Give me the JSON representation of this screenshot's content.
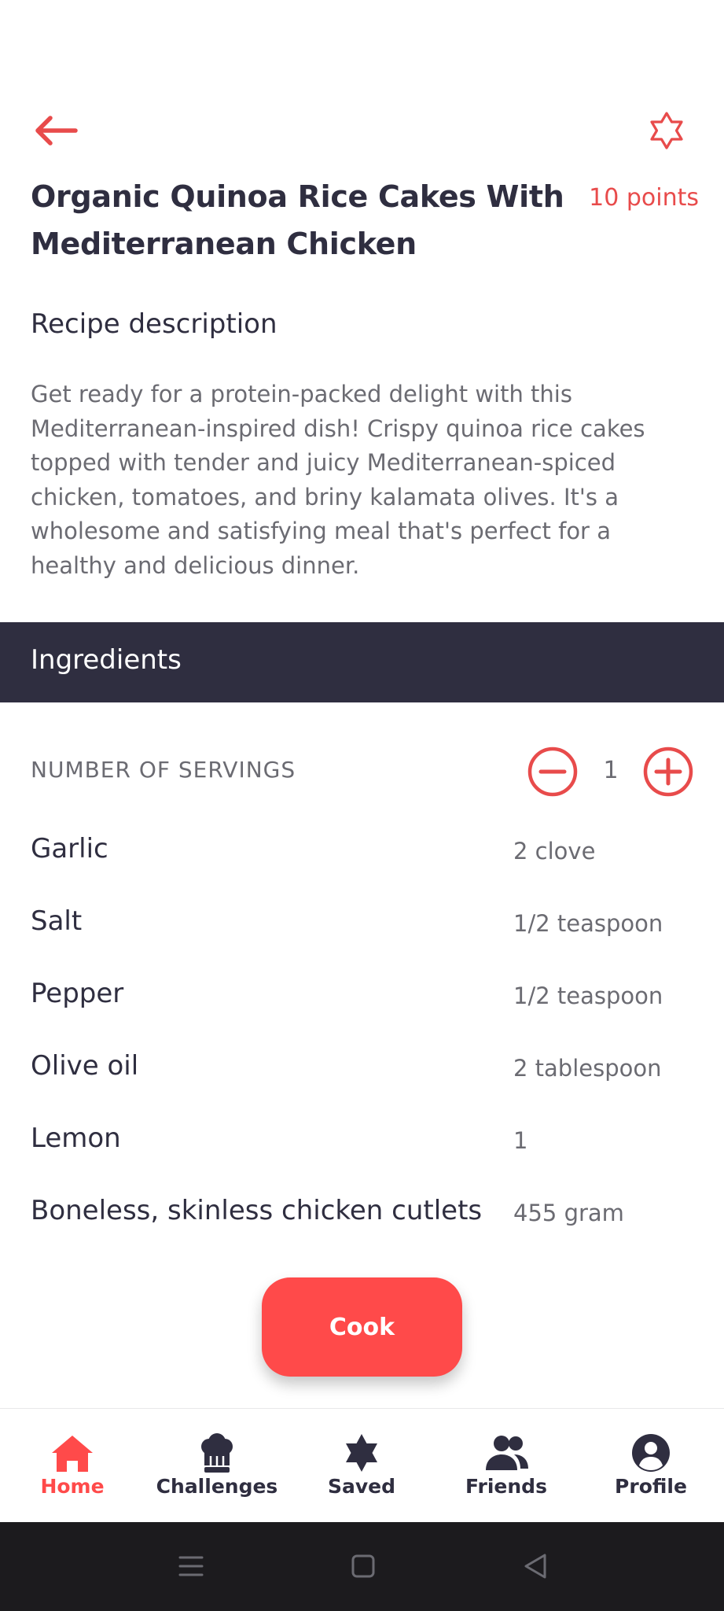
{
  "recipe": {
    "title": "Organic Quinoa Rice Cakes With Mediterranean Chicken",
    "points": "10 points",
    "description_label": "Recipe description",
    "description": "Get ready for a protein-packed delight with this Mediterranean-inspired dish! Crispy quinoa rice cakes topped with tender and juicy Mediterranean-spiced chicken, tomatoes, and briny kalamata olives. It's a wholesome and satisfying meal that's perfect for a healthy and delicious dinner."
  },
  "ingredients": {
    "header": "Ingredients",
    "servings_label": "NUMBER OF SERVINGS",
    "servings_count": "1",
    "items": [
      {
        "name": "Garlic",
        "qty": "2 clove"
      },
      {
        "name": "Salt",
        "qty": "1/2 teaspoon"
      },
      {
        "name": "Pepper",
        "qty": "1/2 teaspoon"
      },
      {
        "name": "Olive oil",
        "qty": "2 tablespoon"
      },
      {
        "name": "Lemon",
        "qty": "1"
      },
      {
        "name": "Boneless, skinless chicken cutlets",
        "qty": "455 gram"
      }
    ]
  },
  "actions": {
    "cook_label": "Cook"
  },
  "nav": {
    "items": [
      {
        "label": "Home",
        "icon": "home-icon",
        "active": true
      },
      {
        "label": "Challenges",
        "icon": "chef-hat-icon",
        "active": false
      },
      {
        "label": "Saved",
        "icon": "star-icon",
        "active": false
      },
      {
        "label": "Friends",
        "icon": "users-icon",
        "active": false
      },
      {
        "label": "Profile",
        "icon": "user-circle-icon",
        "active": false
      }
    ]
  },
  "colors": {
    "accent": "#ff4a4a",
    "accent_text": "#e84b4b",
    "dark": "#2f2e40",
    "muted": "#6b6b72",
    "system_bar": "#1c1b1e"
  }
}
